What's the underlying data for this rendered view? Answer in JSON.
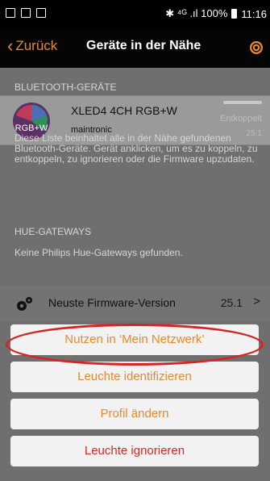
{
  "status_bar": {
    "left_icons": [
      "image-icon",
      "checkbox-icon",
      "calendar-icon"
    ],
    "right_text": "✱ ⁴ᴳ .ıl 100%",
    "time": "11:16"
  },
  "nav": {
    "back_label": "Zurück",
    "title": "Geräte in der Nähe"
  },
  "bluetooth": {
    "section_title": "BLUETOOTH-GERÄTE",
    "device": {
      "avatar_label": "RGB+W",
      "name": "XLED4 4CH RGB+W",
      "manufacturer": "maintronic",
      "status": "Entkoppelt",
      "firmware": "25.1"
    },
    "info": "Diese Liste beinhaltet alle in der Nähe gefundenen Bluetooth-Geräte. Gerät anklicken, um es zu koppeln, zu entkoppeln, zu ignorieren oder die Firmware upzudaten."
  },
  "hue": {
    "section_title": "HUE-GATEWAYS",
    "empty_message": "Keine Philips Hue-Gateways gefunden."
  },
  "firmware_row": {
    "label": "Neuste Firmware-Version",
    "value": "25.1"
  },
  "actions": {
    "use_in_network": "Nutzen in ‘Mein Netzwerk’",
    "identify": "Leuchte identifizieren",
    "change_profile": "Profil ändern",
    "ignore": "Leuchte ignorieren"
  },
  "colors": {
    "accent": "#e8892b",
    "danger": "#d62a1f",
    "highlight_circle": "#d62424"
  }
}
